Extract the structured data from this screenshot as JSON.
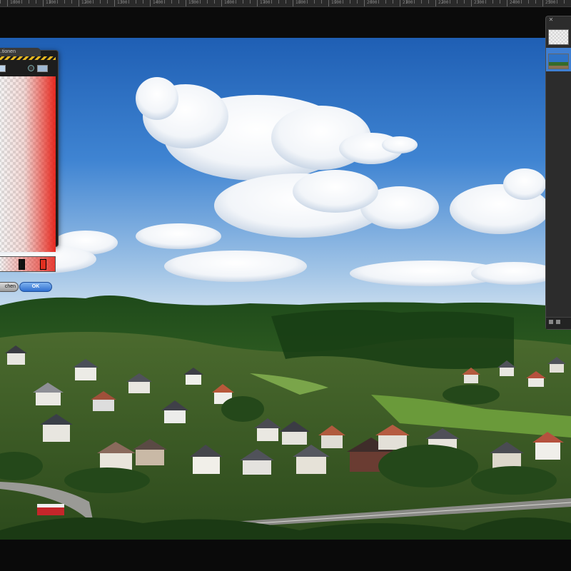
{
  "ruler": {
    "labels": [
      "1000",
      "1100",
      "1200",
      "1300",
      "1400",
      "1500",
      "1600",
      "1700",
      "1800",
      "1900",
      "2000",
      "2100",
      "2200",
      "2300",
      "2400",
      "2500"
    ]
  },
  "canvas": {
    "image": "landscape-photo-village-hills-sky"
  },
  "gradient_panel": {
    "title": "..tionen",
    "cancel_label": "chen",
    "ok_label": "OK",
    "colors": {
      "end_color": "#e02a1c",
      "stop_dark": "#111111",
      "stop_red": "#e03020"
    }
  },
  "layers_panel": {
    "close_icon": "close-icon"
  }
}
